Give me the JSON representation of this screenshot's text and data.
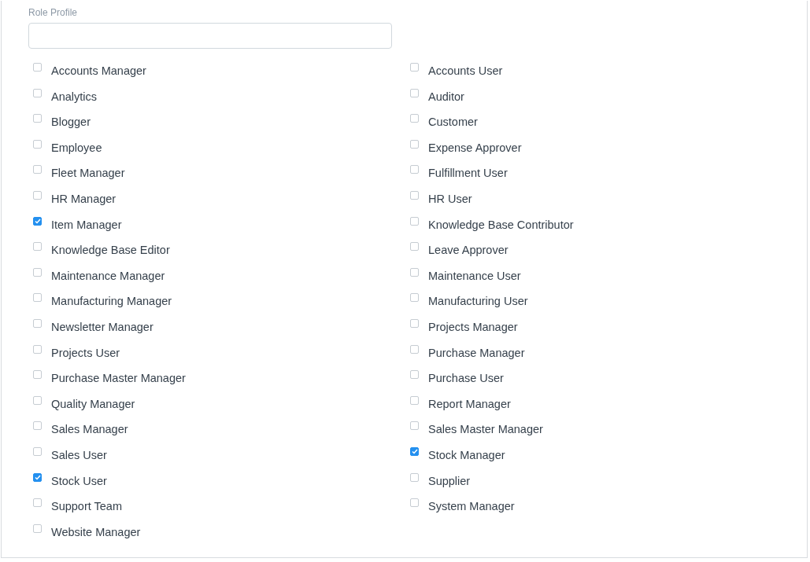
{
  "field": {
    "label": "Role Profile"
  },
  "roles": [
    {
      "label": "Accounts Manager",
      "checked": false
    },
    {
      "label": "Accounts User",
      "checked": false
    },
    {
      "label": "Analytics",
      "checked": false
    },
    {
      "label": "Auditor",
      "checked": false
    },
    {
      "label": "Blogger",
      "checked": false
    },
    {
      "label": "Customer",
      "checked": false
    },
    {
      "label": "Employee",
      "checked": false
    },
    {
      "label": "Expense Approver",
      "checked": false
    },
    {
      "label": "Fleet Manager",
      "checked": false
    },
    {
      "label": "Fulfillment User",
      "checked": false
    },
    {
      "label": "HR Manager",
      "checked": false
    },
    {
      "label": "HR User",
      "checked": false
    },
    {
      "label": "Item Manager",
      "checked": true
    },
    {
      "label": "Knowledge Base Contributor",
      "checked": false
    },
    {
      "label": "Knowledge Base Editor",
      "checked": false
    },
    {
      "label": "Leave Approver",
      "checked": false
    },
    {
      "label": "Maintenance Manager",
      "checked": false
    },
    {
      "label": "Maintenance User",
      "checked": false
    },
    {
      "label": "Manufacturing Manager",
      "checked": false
    },
    {
      "label": "Manufacturing User",
      "checked": false
    },
    {
      "label": "Newsletter Manager",
      "checked": false
    },
    {
      "label": "Projects Manager",
      "checked": false
    },
    {
      "label": "Projects User",
      "checked": false
    },
    {
      "label": "Purchase Manager",
      "checked": false
    },
    {
      "label": "Purchase Master Manager",
      "checked": false
    },
    {
      "label": "Purchase User",
      "checked": false
    },
    {
      "label": "Quality Manager",
      "checked": false
    },
    {
      "label": "Report Manager",
      "checked": false
    },
    {
      "label": "Sales Manager",
      "checked": false
    },
    {
      "label": "Sales Master Manager",
      "checked": false
    },
    {
      "label": "Sales User",
      "checked": false
    },
    {
      "label": "Stock Manager",
      "checked": true
    },
    {
      "label": "Stock User",
      "checked": true
    },
    {
      "label": "Supplier",
      "checked": false
    },
    {
      "label": "Support Team",
      "checked": false
    },
    {
      "label": "System Manager",
      "checked": false
    },
    {
      "label": "Website Manager",
      "checked": false
    }
  ]
}
